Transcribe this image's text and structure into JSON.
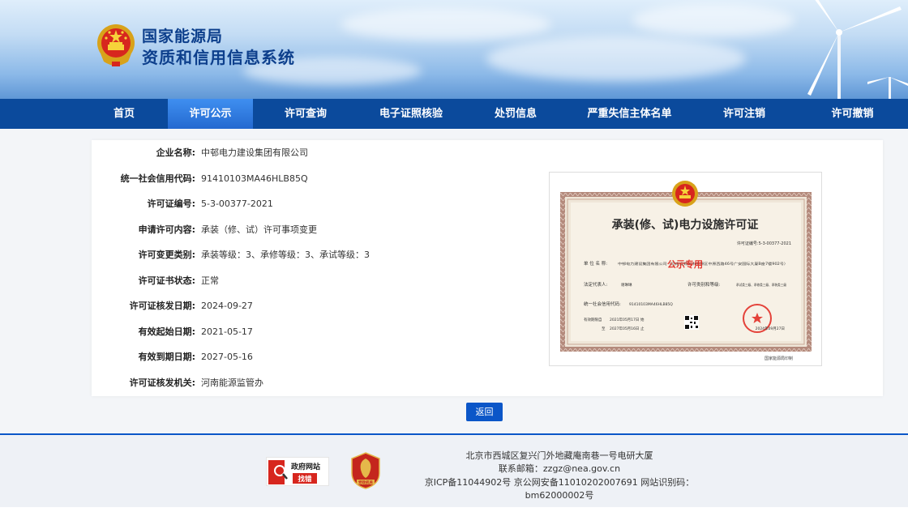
{
  "header": {
    "title_line1": "国家能源局",
    "title_line2": "资质和信用信息系统"
  },
  "nav": [
    {
      "label": "首页"
    },
    {
      "label": "许可公示",
      "active": true
    },
    {
      "label": "许可查询"
    },
    {
      "label": "电子证照核验"
    },
    {
      "label": "处罚信息"
    },
    {
      "label": "严重失信主体名单"
    },
    {
      "label": "许可注销"
    },
    {
      "label": "许可撤销"
    }
  ],
  "details": [
    {
      "label": "企业名称:",
      "value": "中邨电力建设集团有限公司"
    },
    {
      "label": "统一社会信用代码:",
      "value": "91410103MA46HLB85Q"
    },
    {
      "label": "许可证编号:",
      "value": "5-3-00377-2021"
    },
    {
      "label": "申请许可内容:",
      "value": "承装（修、试）许可事项变更"
    },
    {
      "label": "许可变更类别:",
      "value": "承装等级：3、承修等级：3、承试等级：3"
    },
    {
      "label": "许可证书状态:",
      "value": "正常"
    },
    {
      "label": "许可证核发日期:",
      "value": "2024-09-27"
    },
    {
      "label": "有效起始日期:",
      "value": "2021-05-17"
    },
    {
      "label": "有效到期日期:",
      "value": "2027-05-16"
    },
    {
      "label": "许可证核发机关:",
      "value": "河南能源监管办"
    }
  ],
  "certificate": {
    "title": "承装(修、试)电力设施许可证",
    "number": "许可证编号:5-3-00377-2021",
    "unit_label": "单 位 名 称:",
    "unit_value": "中邨电力建设集团有限公司（河南省郑州市中原区中原西路46号广安国际大厦B座7楼902号）",
    "watermark": "公示专用",
    "legal_label": "法定代表人:",
    "legal_value": "谢琳琳",
    "category_label": "许可类别和等级:",
    "category_value": "承试类三级、承修类三级、承装类三级",
    "credit_label": "统一社会信用代码:",
    "credit_value": "91410103MA46HLB85Q",
    "period_label": "有效期限自",
    "period_from": "2021年05月17日",
    "period_from_suffix": "始",
    "period_to_prefix": "至",
    "period_to": "2027年05月16日",
    "period_to_suffix": "止",
    "issue_date": "2024年09月27日",
    "printed_by": "国家能源局印制"
  },
  "back_button": "返回",
  "footer": {
    "address": "北京市西城区复兴门外地藏庵南巷一号电研大厦",
    "email": "联系邮箱：zzgz@nea.gov.cn",
    "icp": "京ICP备11044902号 京公网安备11010202007691 网站识别码：bm62000002号",
    "gov_badge_line1": "政府网站",
    "gov_badge_line2": "找错",
    "party_badge": "党政机关"
  },
  "colors": {
    "nav_bg": "#0b4a9c",
    "nav_active": "#2f7ee6",
    "title": "#0d3f8c",
    "button": "#0b56c8"
  }
}
